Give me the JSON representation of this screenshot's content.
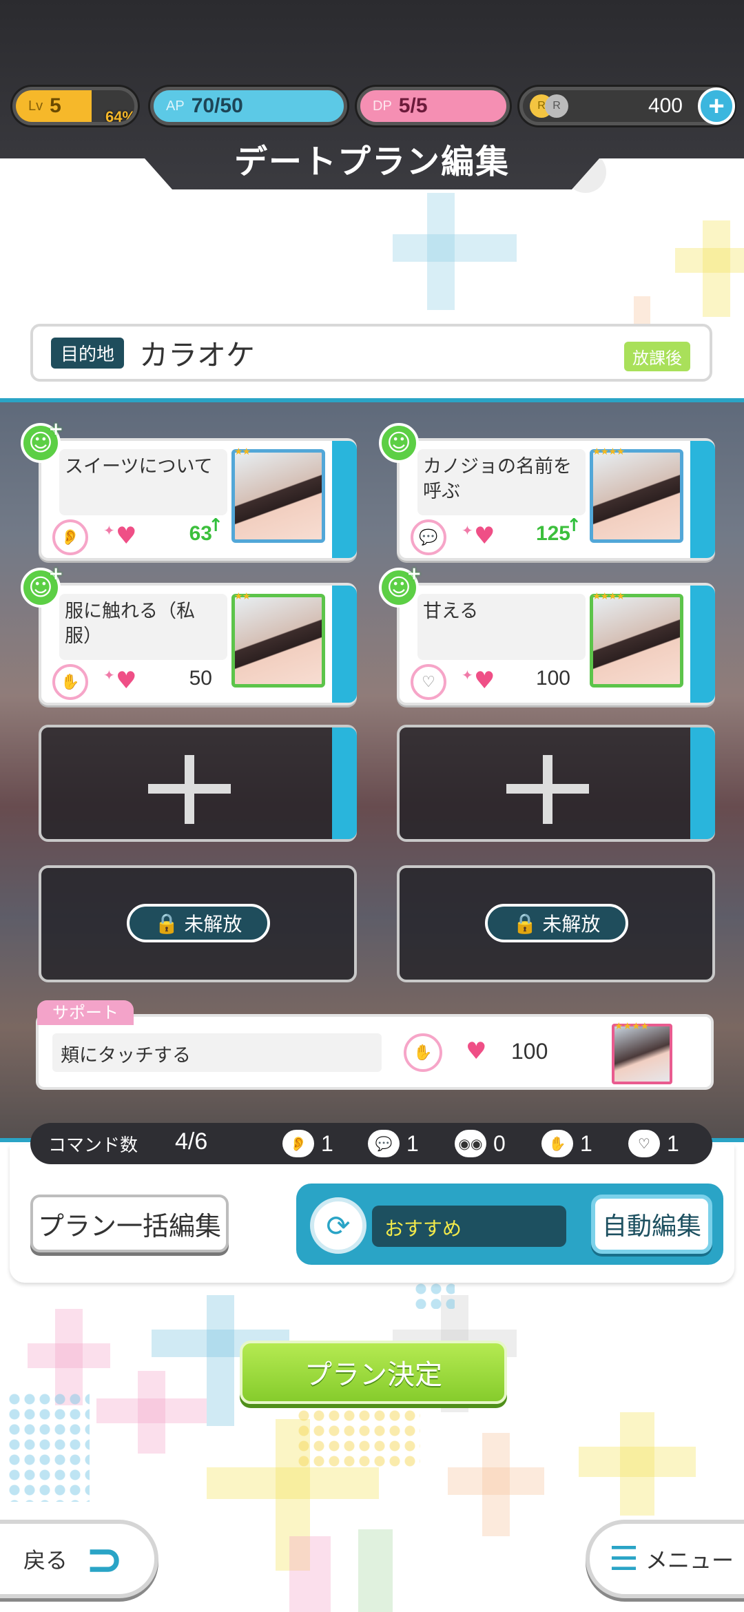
{
  "status": {
    "level_tag": "Lv",
    "level": "5",
    "level_pct": "64%",
    "level_fill": 0.64,
    "ap_tag": "AP",
    "ap": "70/50",
    "dp_tag": "DP",
    "dp": "5/5",
    "coins": "400"
  },
  "title": "デートプラン編集",
  "destination": {
    "label": "目的地",
    "name": "カラオケ",
    "time_badge": "放課後"
  },
  "commands": [
    {
      "title": "スイーツについて",
      "value": "63",
      "boosted": true,
      "stars": "★★",
      "type_icon": "ear-icon"
    },
    {
      "title": "カノジョの名前を呼ぶ",
      "value": "125",
      "boosted": true,
      "stars": "★★★★",
      "type_icon": "speech-bubble-icon"
    },
    {
      "title": "服に触れる（私服）",
      "value": "50",
      "boosted": false,
      "stars": "★★",
      "type_icon": "touch-icon"
    },
    {
      "title": "甘える",
      "value": "100",
      "boosted": false,
      "stars": "★★★★",
      "type_icon": "heart-bubble-icon"
    }
  ],
  "locked_label": "未解放",
  "support": {
    "tag": "サポート",
    "title": "頬にタッチする",
    "value": "100",
    "stars": "★★★★"
  },
  "command_count": {
    "label": "コマンド数",
    "value": "4/6",
    "ear": "1",
    "talk": "1",
    "look": "0",
    "touch": "1",
    "love": "1"
  },
  "buttons": {
    "bulk_edit": "プラン一括編集",
    "recommend": "おすすめ",
    "auto_edit": "自動編集",
    "decide": "プラン決定",
    "back": "戻る",
    "menu": "メニュー"
  },
  "colors": {
    "accent": "#2aa4c6",
    "pink": "#ef4f86",
    "green": "#86cc2c",
    "dark": "#1f4d5c"
  }
}
